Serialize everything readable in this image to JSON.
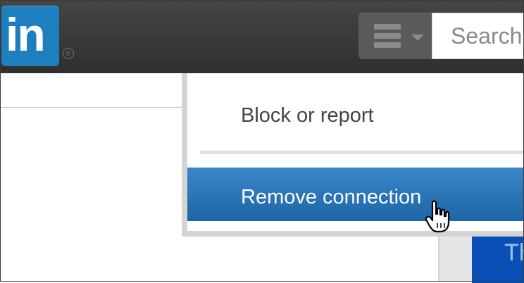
{
  "header": {
    "logo_text": "in",
    "registered_mark": "®",
    "search_placeholder": "Search"
  },
  "dropdown": {
    "items": [
      {
        "label": "Block or report"
      },
      {
        "label": "Remove connection"
      }
    ]
  },
  "background": {
    "partial_button_text": "Th"
  },
  "colors": {
    "brand": "#1e7fbf",
    "highlight": "#2a76bb",
    "topbar": "#3a3a3a"
  },
  "icons": [
    "menu-icon",
    "chevron-down-icon",
    "hand-pointer-icon"
  ]
}
